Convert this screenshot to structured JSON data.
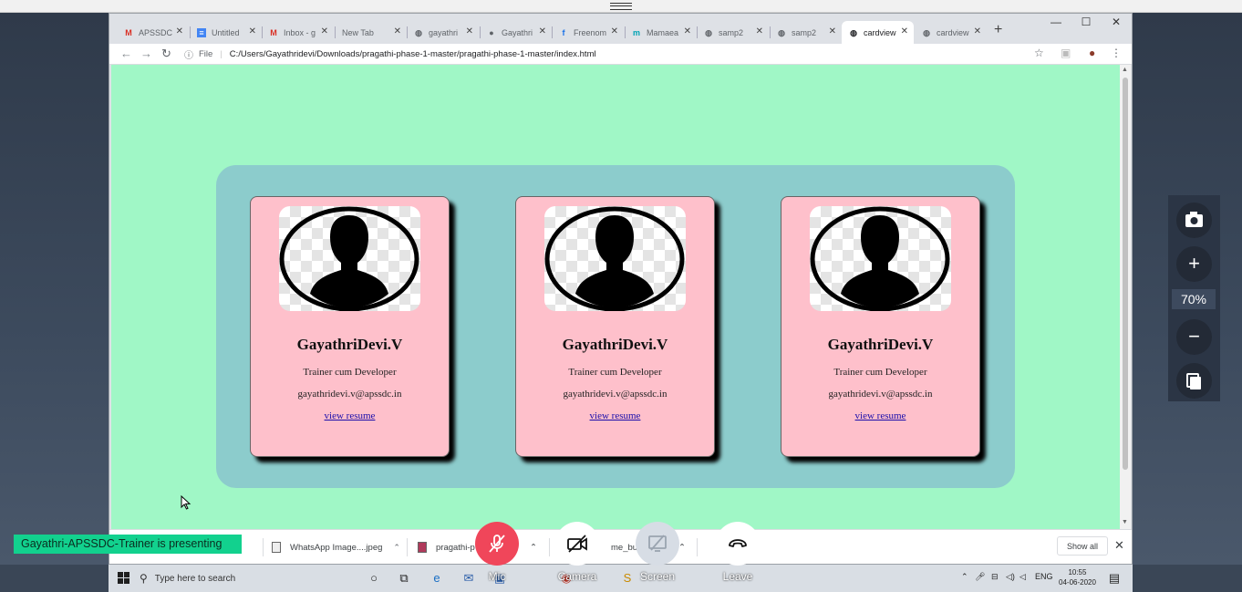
{
  "browser": {
    "tabs": [
      {
        "title": "APSSDC",
        "icon": "gmail-icon"
      },
      {
        "title": "Untitled",
        "icon": "docs-icon"
      },
      {
        "title": "Inbox - g",
        "icon": "gmail-icon"
      },
      {
        "title": "New Tab",
        "icon": ""
      },
      {
        "title": "gayathri",
        "icon": "globe-icon"
      },
      {
        "title": "Gayathri",
        "icon": "github-icon"
      },
      {
        "title": "Freenom",
        "icon": "freenom-icon"
      },
      {
        "title": "Mamaea",
        "icon": "m-icon"
      },
      {
        "title": "samp2",
        "icon": "globe-icon"
      },
      {
        "title": "samp2",
        "icon": "globe-icon"
      },
      {
        "title": "cardview",
        "icon": "globe-icon",
        "active": true
      },
      {
        "title": "cardview",
        "icon": "globe-icon"
      }
    ],
    "address": {
      "scheme": "File",
      "url": "C:/Users/Gayathridevi/Downloads/pragathi-phase-1-master/pragathi-phase-1-master/index.html"
    }
  },
  "page": {
    "background": "#a0f7c6",
    "panel_color": "#8ccccc",
    "card_color": "#fec0cb",
    "cards": [
      {
        "name": "GayathriDevi.V",
        "role": "Trainer cum Developer",
        "email": "gayathridevi.v@apssdc.in",
        "link": "view resume"
      },
      {
        "name": "GayathriDevi.V",
        "role": "Trainer cum Developer",
        "email": "gayathridevi.v@apssdc.in",
        "link": "view resume"
      },
      {
        "name": "GayathriDevi.V",
        "role": "Trainer cum Developer",
        "email": "gayathridevi.v@apssdc.in",
        "link": "view resume"
      }
    ]
  },
  "downloads": {
    "items": [
      "WhatsApp Image....jpeg",
      "pragathi-p",
      "me_builde"
    ],
    "show_all": "Show all"
  },
  "taskbar": {
    "search_placeholder": "Type here to search",
    "language": "ENG",
    "time": "10:55",
    "date": "04-06-2020"
  },
  "meeting": {
    "presenting": "Gayathri-APSSDC-Trainer is presenting",
    "zoom_level": "70%",
    "controls": {
      "mic": "Mic",
      "camera": "Camera",
      "screen": "Screen",
      "leave": "Leave"
    },
    "colors": {
      "mic": "#f0465a",
      "presenting": "#12d18e"
    }
  }
}
